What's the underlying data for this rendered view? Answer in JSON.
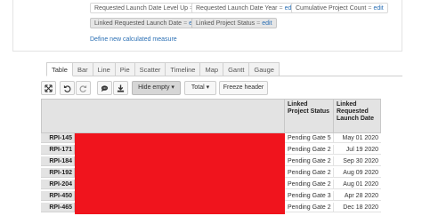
{
  "measures": {
    "chips": [
      {
        "label": "Requested Launch Date Level Up",
        "edit": "edit",
        "selected": false
      },
      {
        "label": "Requested Launch Date Year",
        "edit": "edit",
        "selected": false
      },
      {
        "label": "Cumulative Project Count",
        "edit": "edit",
        "selected": false
      },
      {
        "label": "Linked Requested Launch Date",
        "edit": "edit",
        "selected": true
      },
      {
        "label": "Linked Project Status",
        "edit": "edit",
        "selected": true
      }
    ],
    "eq": "=",
    "define_link": "Define new calculated measure"
  },
  "tabs": [
    "Table",
    "Bar",
    "Line",
    "Pie",
    "Scatter",
    "Timeline",
    "Map",
    "Gantt",
    "Gauge"
  ],
  "active_tab": "Table",
  "toolbar": {
    "hide_empty": "Hide empty",
    "total": "Total",
    "freeze_header": "Freeze header",
    "caret": "▾"
  },
  "table": {
    "headers": [
      "Linked Project Status",
      "Linked Requested Launch Date"
    ],
    "rows": [
      {
        "label": "RPI-145",
        "status": "Pending Gate 5",
        "date": "May 01 2020"
      },
      {
        "label": "RPI-171",
        "status": "Pending Gate 2",
        "date": "Jul 19 2020"
      },
      {
        "label": "RPI-184",
        "status": "Pending Gate 2",
        "date": "Sep 30 2020"
      },
      {
        "label": "RPI-192",
        "status": "Pending Gate 2",
        "date": "Aug 09 2020"
      },
      {
        "label": "RPI-204",
        "status": "Pending Gate 2",
        "date": "Aug 01 2020"
      },
      {
        "label": "RPI-450",
        "status": "Pending Gate 3",
        "date": "Apr 28 2020"
      },
      {
        "label": "RPI-465",
        "status": "Pending Gate 2",
        "date": "Dec 18 2020"
      }
    ]
  },
  "colors": {
    "redaction": "#f0141d",
    "link": "#2a6fb4"
  }
}
